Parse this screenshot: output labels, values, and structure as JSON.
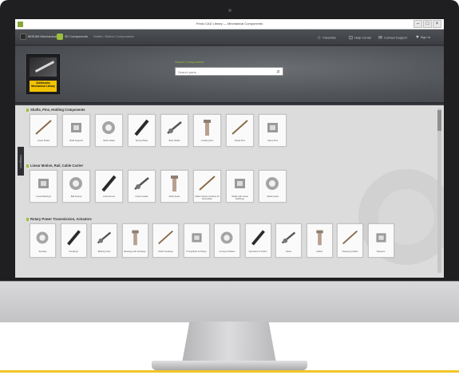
{
  "window": {
    "title": "Festo CAD Library — Mechanical Components"
  },
  "nav": {
    "item1": "MISUMI Mechanical",
    "item2": "3D Components",
    "breadcrumb": "Shafts / Motion Components"
  },
  "header_links": {
    "link1": "Favorites",
    "link2": "Help Center",
    "link3": "Contact Support",
    "link4": "Sign In"
  },
  "hero": {
    "logo_title": "Solidworks Mechanical Library",
    "search_label": "Search Components",
    "search_placeholder": "Search parts..."
  },
  "sidebar_tab": "Categories",
  "sections": [
    {
      "title": "Shafts, Pins, Holding Components",
      "items": [
        {
          "label": "Linear Shafts",
          "icon": "linear-shaft"
        },
        {
          "label": "Shaft Supports",
          "icon": "shaft-support"
        },
        {
          "label": "Shaft Collars",
          "icon": "shaft-collar"
        },
        {
          "label": "Spring Plates",
          "icon": "spring-plate"
        },
        {
          "label": "Boss Shafts",
          "icon": "boss-shaft"
        },
        {
          "label": "Locating Pins",
          "icon": "locating-pin"
        },
        {
          "label": "Dowel Pins",
          "icon": "dowel-pin"
        },
        {
          "label": "Clamp Pins",
          "icon": "clamp-pin"
        }
      ]
    },
    {
      "title": "Linear Motion, Rail, Cable Carrier",
      "items": [
        {
          "label": "Linear Bushings",
          "icon": "linear-bushing"
        },
        {
          "label": "Ball Screws",
          "icon": "ball-screw"
        },
        {
          "label": "Lead Screws",
          "icon": "lead-screw"
        },
        {
          "label": "Linear Guides",
          "icon": "linear-guide"
        },
        {
          "label": "Rack Gears",
          "icon": "rack-gear"
        },
        {
          "label": "Cable Carriers (Chains) for Automation",
          "icon": "cable-carrier"
        },
        {
          "label": "Shafts with Linear Bushings",
          "icon": "shaft-bushing"
        },
        {
          "label": "Cable Hooks",
          "icon": "cable-hook"
        }
      ]
    },
    {
      "title": "Rotary Power Transmission, Actuators",
      "items": [
        {
          "label": "Spindles",
          "icon": "spindle"
        },
        {
          "label": "Couplings",
          "icon": "coupling"
        },
        {
          "label": "Bearing Units",
          "icon": "bearing-unit"
        },
        {
          "label": "Bearings with Housings",
          "icon": "bearing-housing"
        },
        {
          "label": "Shaft Couplings",
          "icon": "shaft-coupling"
        },
        {
          "label": "Timing Belts & Pulleys",
          "icon": "timing-pulley"
        },
        {
          "label": "Conveyor Rollers",
          "icon": "conveyor-roller"
        },
        {
          "label": "Sprockets & Chains",
          "icon": "sprocket"
        },
        {
          "label": "Gears",
          "icon": "gear"
        },
        {
          "label": "Collars",
          "icon": "collar"
        },
        {
          "label": "Clamping Collars",
          "icon": "clamp-collar"
        },
        {
          "label": "Dampers",
          "icon": "damper"
        }
      ]
    }
  ],
  "colors": {
    "accent": "#9bbf3b",
    "logo_yellow": "#f2c300",
    "header": "#3c3e43",
    "content_bg": "#dcdcdc"
  }
}
